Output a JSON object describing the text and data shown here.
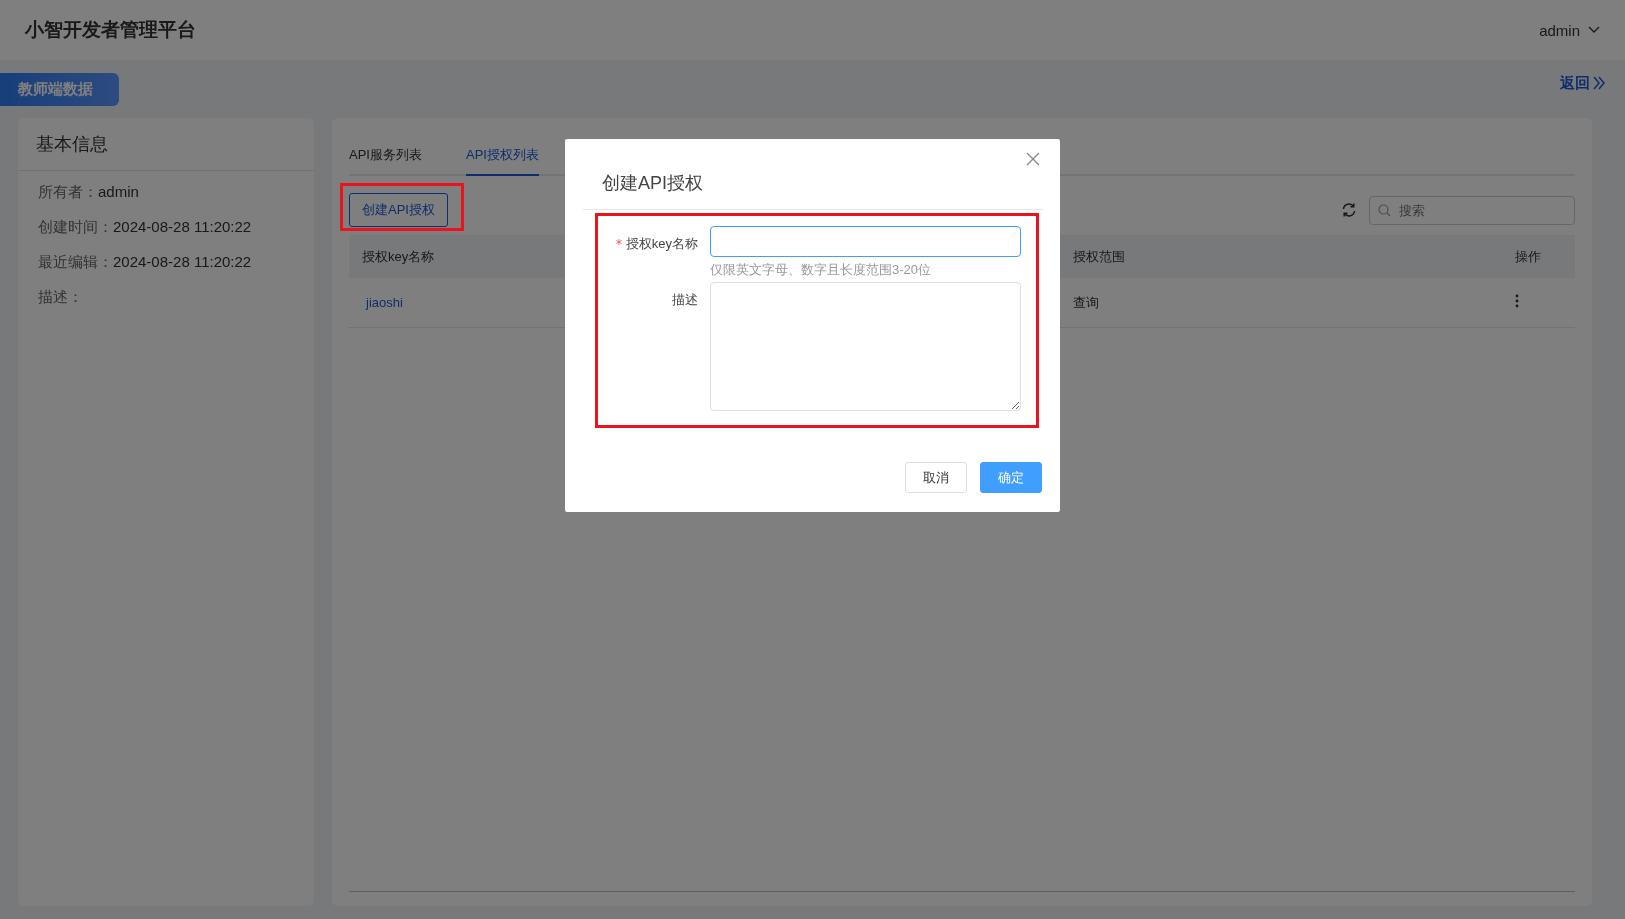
{
  "header": {
    "title": "小智开发者管理平台",
    "user": "admin"
  },
  "section_tag": "教师端数据",
  "back_link": "返回",
  "info_panel": {
    "title": "基本信息",
    "fields": [
      {
        "label": "所有者：",
        "value": "admin"
      },
      {
        "label": "创建时间：",
        "value": "2024-08-28 11:20:22"
      },
      {
        "label": "最近编辑：",
        "value": "2024-08-28 11:20:22"
      },
      {
        "label": "描述："
      }
    ]
  },
  "tabs": [
    {
      "label": "API服务列表",
      "selected": false
    },
    {
      "label": "API授权列表",
      "selected": true
    }
  ],
  "create_button": "创建API授权",
  "search": {
    "placeholder": "搜索"
  },
  "table": {
    "columns": [
      "授权key名称",
      "授权范围",
      "操作"
    ],
    "rows": [
      {
        "cells": [
          "jiaoshi",
          "查询"
        ]
      }
    ]
  },
  "dialog": {
    "title": "创建API授权",
    "fields": [
      {
        "kind": "input",
        "label": "授权key名称",
        "required": true,
        "hint": "仅限英文字母、数字且长度范围3-20位",
        "focused": true
      },
      {
        "kind": "textarea",
        "label": "描述",
        "required": false,
        "focused": false
      }
    ],
    "buttons": [
      {
        "label": "取消",
        "kind": "secondary"
      },
      {
        "label": "确定",
        "kind": "primary"
      }
    ]
  }
}
